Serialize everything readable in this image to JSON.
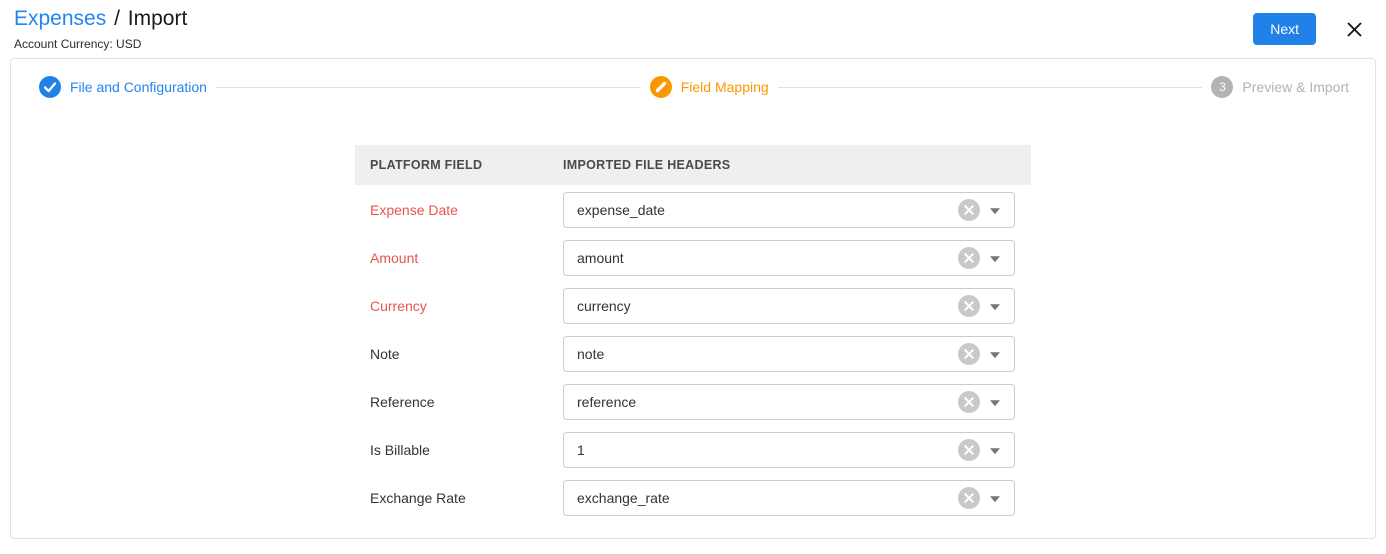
{
  "header": {
    "breadcrumb": {
      "primary": "Expenses",
      "separator": "/",
      "secondary": "Import"
    },
    "subtitle": "Account Currency: USD",
    "next_button": "Next",
    "close_icon": "x-close"
  },
  "stepper": {
    "steps": [
      {
        "label": "File and Configuration",
        "state": "complete",
        "icon": "check-icon"
      },
      {
        "label": "Field Mapping",
        "state": "active",
        "icon": "pencil-icon"
      },
      {
        "label": "Preview & Import",
        "state": "upcoming",
        "number": "3"
      }
    ]
  },
  "mapping_table": {
    "columns": [
      "PLATFORM FIELD",
      "IMPORTED FILE HEADERS"
    ],
    "rows": [
      {
        "field": "Expense Date",
        "required": true,
        "value": "expense_date"
      },
      {
        "field": "Amount",
        "required": true,
        "value": "amount"
      },
      {
        "field": "Currency",
        "required": true,
        "value": "currency"
      },
      {
        "field": "Note",
        "required": false,
        "value": "note"
      },
      {
        "field": "Reference",
        "required": false,
        "value": "reference"
      },
      {
        "field": "Is Billable",
        "required": false,
        "value": "1"
      },
      {
        "field": "Exchange Rate",
        "required": false,
        "value": "exchange_rate"
      }
    ],
    "row_icons": [
      "clear-circle-icon",
      "chevron-down-icon"
    ]
  },
  "colors": {
    "accent_blue": "#2081e8",
    "accent_orange": "#fb9700",
    "required_red": "#e8554d",
    "upcoming_gray": "#b3b3b3",
    "table_header_bg": "#efefef"
  }
}
